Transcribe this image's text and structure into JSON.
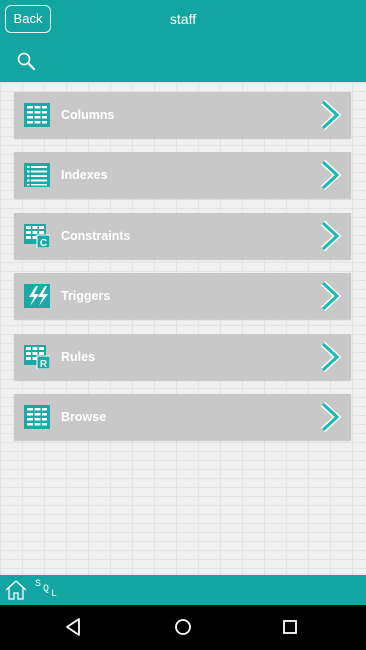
{
  "header": {
    "back_label": "Back",
    "title": "staff",
    "search_icon": "search-icon"
  },
  "menu": {
    "items": [
      {
        "label": "Columns",
        "icon": "table-icon"
      },
      {
        "label": "Indexes",
        "icon": "list-icon"
      },
      {
        "label": "Constraints",
        "icon": "constraints-icon"
      },
      {
        "label": "Triggers",
        "icon": "lightning-icon"
      },
      {
        "label": "Rules",
        "icon": "rules-icon"
      },
      {
        "label": "Browse",
        "icon": "table-icon"
      }
    ]
  },
  "footer": {
    "home_icon": "home-icon",
    "sql_glyphs": [
      "S",
      "Q",
      "L"
    ]
  },
  "colors": {
    "accent": "#12a5a1",
    "item_background": "#c8c8c8",
    "item_text": "#ffffff",
    "chevron": "#1fb8b3"
  }
}
